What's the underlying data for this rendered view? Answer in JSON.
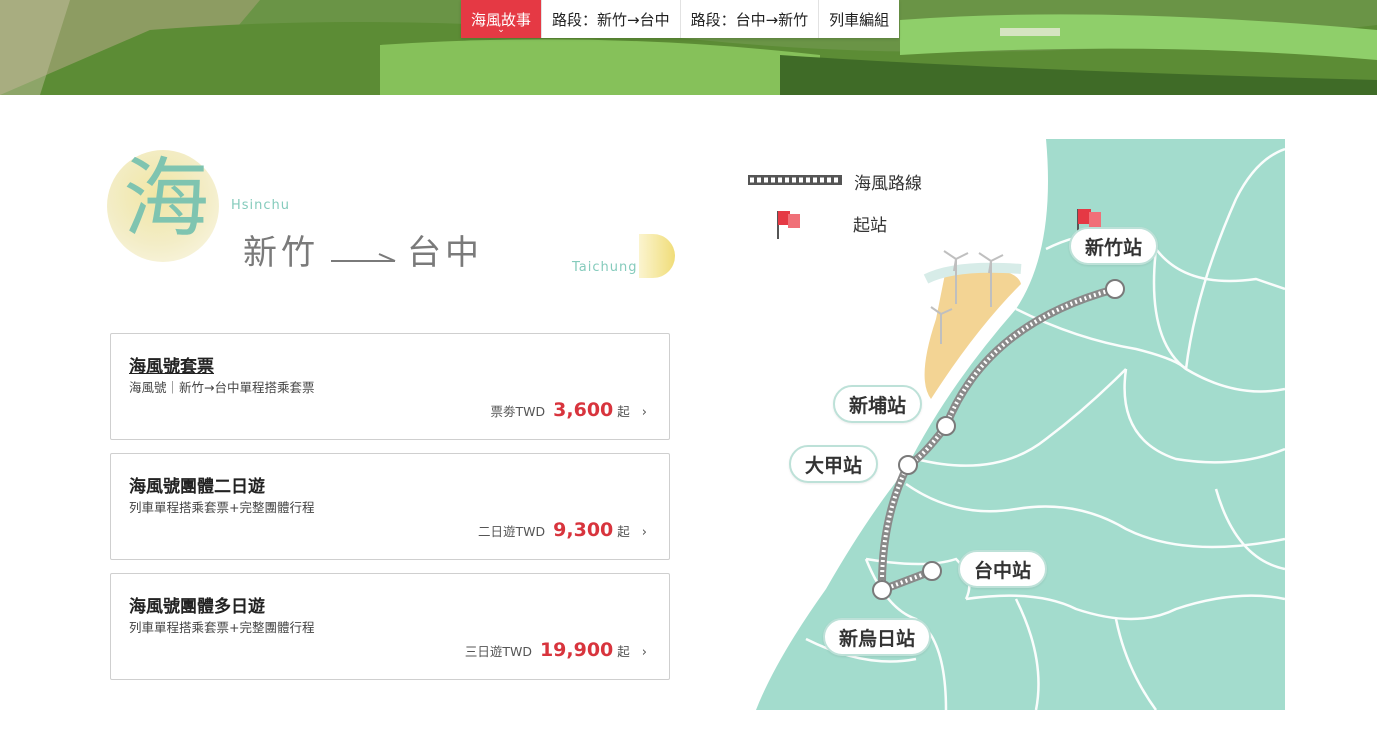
{
  "tabs": [
    {
      "label": "海風故事",
      "active": true
    },
    {
      "label": "路段：新竹→台中",
      "active": false
    },
    {
      "label": "路段：台中→新竹",
      "active": false
    },
    {
      "label": "列車編組",
      "active": false
    }
  ],
  "title": {
    "big_char": "海",
    "from_en": "Hsinchu",
    "from": "新竹",
    "to": "台中",
    "to_en": "Taichung"
  },
  "products": [
    {
      "title": "海風號套票",
      "subtitle": "海風號｜新竹→台中單程搭乘套票",
      "price_label": "票劵TWD",
      "price": "3,600",
      "price_suffix": "起"
    },
    {
      "title": "海風號團體二日遊",
      "subtitle": "列車單程搭乘套票+完整團體行程",
      "price_label": "二日遊TWD",
      "price": "9,300",
      "price_suffix": "起"
    },
    {
      "title": "海風號團體多日遊",
      "subtitle": "列車單程搭乘套票+完整團體行程",
      "price_label": "三日遊TWD",
      "price": "19,900",
      "price_suffix": "起"
    }
  ],
  "map": {
    "legend": {
      "route": "海風路線",
      "start": "起站"
    },
    "stations": [
      "新竹站",
      "新埔站",
      "大甲站",
      "台中站",
      "新烏日站"
    ]
  },
  "colors": {
    "accent_red": "#e53944",
    "price_red": "#d8343d",
    "map_land": "#a3dccd",
    "title_teal": "#7fc4b0"
  },
  "icons": {
    "chevron_right": "›",
    "chevron_down": "⌄"
  }
}
